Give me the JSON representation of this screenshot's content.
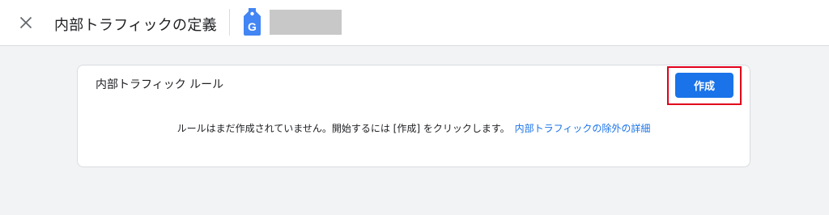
{
  "header": {
    "title": "内部トラフィックの定義",
    "close_icon": "close-icon",
    "product_icon": "tag-manager-icon",
    "account_name": ""
  },
  "card": {
    "title": "内部トラフィック ルール",
    "create_button_label": "作成",
    "empty_message": "ルールはまだ作成されていません。開始するには [作成] をクリックします。",
    "learn_more_link": "内部トラフィックの除外の詳細"
  },
  "colors": {
    "accent": "#1a73e8",
    "highlight": "#e0001b",
    "background": "#f1f3f4"
  }
}
